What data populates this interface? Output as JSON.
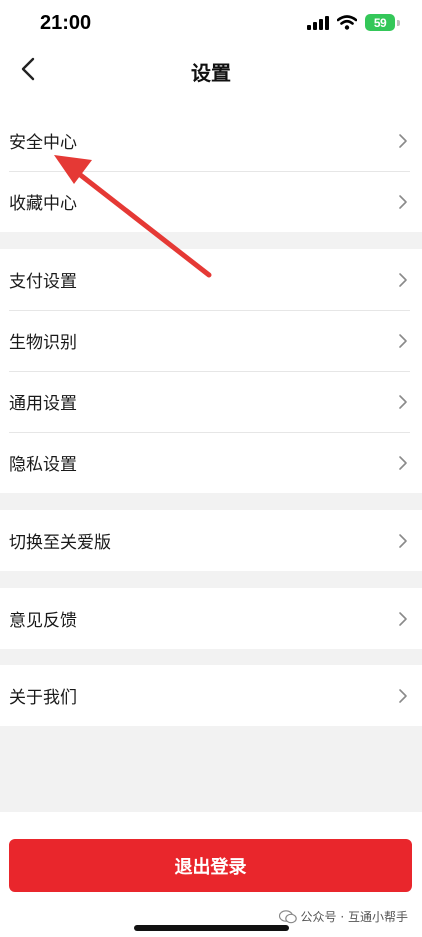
{
  "status_bar": {
    "time": "21:00",
    "battery": "59"
  },
  "nav": {
    "title": "设置"
  },
  "groups": [
    [
      {
        "label": "安全中心"
      },
      {
        "label": "收藏中心"
      }
    ],
    [
      {
        "label": "支付设置"
      },
      {
        "label": "生物识别"
      },
      {
        "label": "通用设置"
      },
      {
        "label": "隐私设置"
      }
    ],
    [
      {
        "label": "切换至关爱版"
      }
    ],
    [
      {
        "label": "意见反馈"
      }
    ],
    [
      {
        "label": "关于我们"
      }
    ]
  ],
  "logout": {
    "label": "退出登录"
  },
  "watermark": {
    "text": "公众号 · 互通小帮手"
  },
  "colors": {
    "accent": "#e9262c",
    "battery": "#34c759",
    "background": "#f2f2f2",
    "arrow": "#e53935"
  }
}
